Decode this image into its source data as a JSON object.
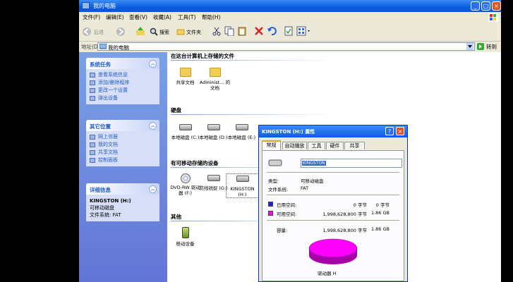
{
  "window": {
    "title": "我的电脑"
  },
  "menu": [
    "文件(F)",
    "编辑(E)",
    "查看(V)",
    "收藏(A)",
    "工具(T)",
    "帮助(H)"
  ],
  "toolbar": {
    "back": "后退",
    "search": "搜索",
    "folders": "文件夹"
  },
  "address": {
    "label": "地址(D)",
    "value": "我的电脑",
    "go": "转到"
  },
  "tasks": {
    "system": {
      "title": "系统任务",
      "items": [
        "查看系统信息",
        "添加/删除程序",
        "更改一个设置",
        "弹出设备"
      ]
    },
    "other": {
      "title": "其它位置",
      "items": [
        "网上邻居",
        "我的文档",
        "共享文档",
        "控制面板"
      ]
    },
    "details": {
      "title": "详细信息",
      "name": "KINGSTON (H:)",
      "type": "可移动磁盘",
      "fs": "文件系统: FAT"
    }
  },
  "sections": {
    "files": {
      "title": "在这台计算机上存储的文件",
      "items": [
        "共享文档",
        "Administ... 的文档"
      ]
    },
    "hdd": {
      "title": "硬盘",
      "items": [
        "本地磁盘 (C:)",
        "本地磁盘 (D:)",
        "本地磁盘 (E:)"
      ]
    },
    "removable": {
      "title": "有可移动存储的设备",
      "items": [
        "DVD-RW 驱动器 (F:)",
        "防线锐捉 (G:)",
        "KINGSTON (H:)"
      ]
    },
    "other": {
      "title": "其他",
      "items": [
        "移动设备"
      ]
    }
  },
  "dialog": {
    "title": "KINGSTON (H:) 属性",
    "tabs": [
      "常规",
      "自动播放",
      "工具",
      "硬件",
      "共享"
    ],
    "name": "KINGSTON",
    "type_label": "类型:",
    "type_value": "可移动磁盘",
    "fs_label": "文件系统:",
    "fs_value": "FAT",
    "used_label": "已用空间:",
    "used_bytes": "0 字节",
    "used_size": "0 字节",
    "free_label": "可用空间:",
    "free_bytes": "1,998,628,800 字节",
    "free_size": "1.86 GB",
    "cap_label": "容量:",
    "cap_bytes": "1,998,628,800 字节",
    "cap_size": "1.86 GB",
    "drive_label": "驱动器 H",
    "colors": {
      "used": "#1e1ee0",
      "free": "#ff00ff"
    }
  }
}
